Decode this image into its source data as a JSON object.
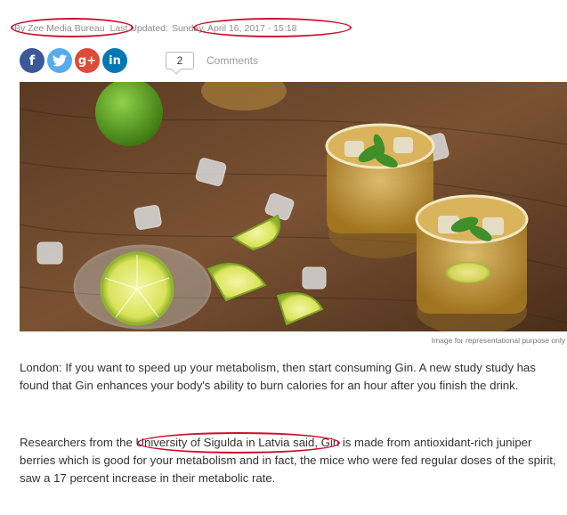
{
  "article": {
    "byline": "By Zee Media Bureau",
    "updated_label": "Last Updated:",
    "updated_date": "Sunday, April 16, 2017 - 15:18",
    "comment_count": "2",
    "comments_label": "Comments",
    "image_caption": "Image for representational purpose only",
    "paragraphs": [
      "London: If you want to speed up your metabolism, then start consuming Gin. A new study study has found that Gin enhances your body's ability to burn calories for an hour after you finish the drink.",
      "Researchers from the University of Sigulda in Latvia said, Gin is made from antioxidant-rich juniper berries which is good for your metabolism and in fact, the mice who were fed regular doses of the spirit, saw a 17 percent increase in their metabolic rate."
    ],
    "p2_before": "Researchers from the ",
    "p2_highlight": "University of Sigulda in Latvia",
    "p2_after": " said, Gin is made from antioxidant-rich juniper berries which is good for your metabolism and in fact, the mice who were fed regular doses of the spirit, saw a 17 percent increase in their metabolic rate."
  },
  "share": {
    "facebook_glyph": "f",
    "google_glyph": "g+",
    "linkedin_glyph": "in"
  },
  "colors": {
    "annotation_red": "#c8102e",
    "facebook": "#3b5998",
    "twitter": "#55acee",
    "googleplus": "#dd4b39",
    "linkedin": "#0077b5"
  },
  "icons": [
    "facebook-icon",
    "twitter-icon",
    "google-plus-icon",
    "linkedin-icon",
    "comment-bubble-icon"
  ]
}
